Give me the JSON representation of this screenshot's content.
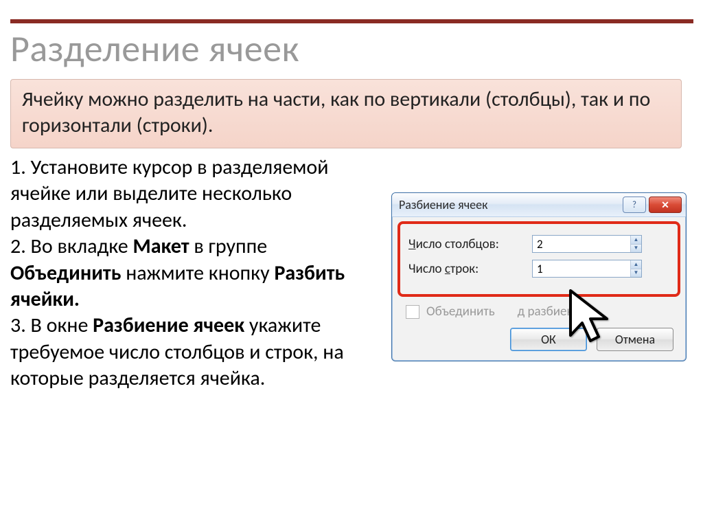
{
  "slide": {
    "title": "Разделение ячеек",
    "highlight": "Ячейку можно разделить на части, как по вертикали (столбцы), так и по горизонтали (строки).",
    "steps": {
      "s1": "1. Установите курсор в разделяемой ячейке или выделите несколько разделяемых ячеек.",
      "s2a": "2. Во вкладке ",
      "s2b": "Макет",
      "s2c": " в группе ",
      "s2d": "Объединить",
      "s2e": " нажмите кнопку ",
      "s2f": "Разбить ячейки.",
      "s3a": "3. В окне ",
      "s3b": "Разбиение ячеек",
      "s3c": "  укажите требуемое число столбцов и строк, на которые разделяется ячейка."
    }
  },
  "dialog": {
    "title": "Разбиение ячеек",
    "help_icon": "?",
    "close_icon": "✕",
    "cols_label_u": "Ч",
    "cols_label_rest": "исло столбцов:",
    "cols_value": "2",
    "rows_label": "Число ",
    "rows_label_u": "с",
    "rows_label_rest": "трок:",
    "rows_value": "1",
    "merge_label_a": "Объединить ",
    "merge_label_b": "д разбиением",
    "ok": "ОК",
    "cancel": "Отмена"
  }
}
